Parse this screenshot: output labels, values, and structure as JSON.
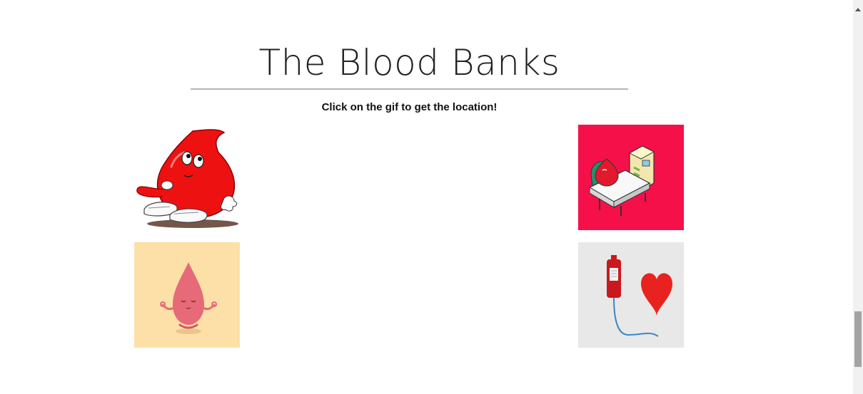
{
  "page": {
    "title": "The Blood Banks",
    "instruction": "Click on the gif to get the location!"
  },
  "gifs": [
    {
      "name": "cartoon-blood-drop-thinking",
      "background": "#ffffff"
    },
    {
      "name": "blood-donation-bed-illustration",
      "background": "#f5104a"
    },
    {
      "name": "meditating-blood-drop",
      "background": "#fde0a8"
    },
    {
      "name": "blood-bag-heart",
      "background": "#e8e8e8"
    }
  ],
  "colors": {
    "blood_red": "#ee1111",
    "rule": "#b5b5b5"
  }
}
